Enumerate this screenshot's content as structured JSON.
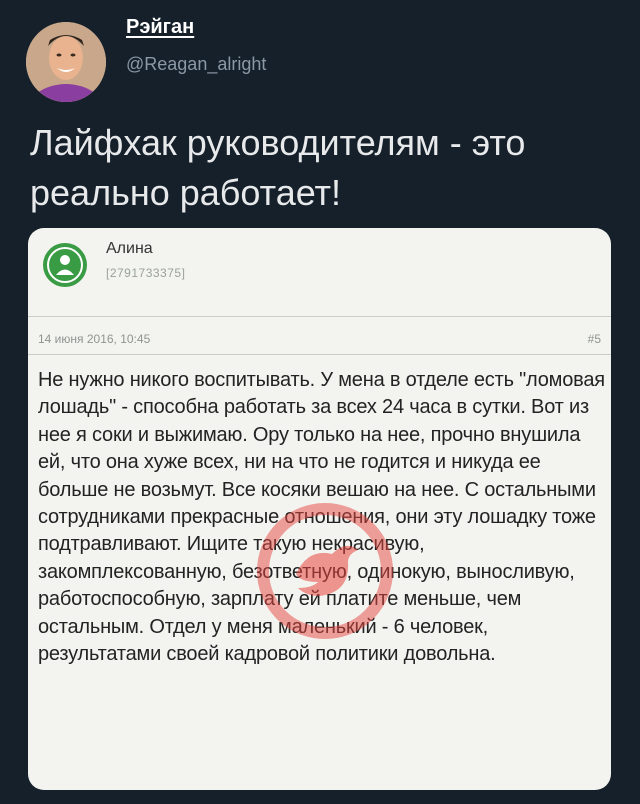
{
  "author": {
    "name": "Рэйган",
    "handle": "@Reagan_alright"
  },
  "tweet": {
    "text": "Лайфхак руководителям - это реально работает!"
  },
  "screenshot": {
    "user_name": "Алина",
    "user_id": "[2791733375]",
    "date": "14 июня 2016, 10:45",
    "post_number": "#5",
    "body": "Не нужно никого воспитывать. У мена в отделе есть \"ломовая лошадь\" - способна работать за всех 24 часа в сутки. Вот из нее я соки и выжимаю. Ору только на нее, прочно внушила ей, что она хуже всех, ни на что не годится и никуда ее больше не возьмут. Все косяки вешаю на нее. С остальными сотрудниками прекрасные отношения, они эту лошадку тоже подтравливают. Ищите такую некрасивую, закомплексованную, безответную, одинокую, выносливую, работоспособную, зарплату ей платите меньше, чем остальным. Отдел у меня маленький - 6 человек, результатами своей кадровой политики довольна."
  },
  "colors": {
    "background": "#15202b",
    "card": "#f3f4f0",
    "avatar_green": "#3a9b45",
    "watermark": "#e8463f"
  }
}
